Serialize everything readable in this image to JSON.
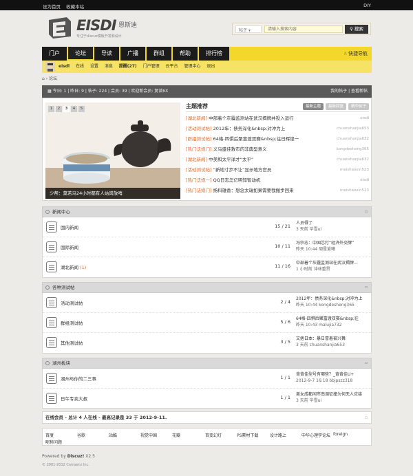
{
  "topbar": {
    "set_home": "设为首页",
    "bookmark": "收藏本站",
    "diy": "DIY"
  },
  "brand": {
    "name": "EISDI",
    "cn": "恩斯迪",
    "tagline": "专注于discuz模板开发和设计"
  },
  "search": {
    "type": "帖子",
    "placeholder": "请输入搜索内容",
    "button": "搜索"
  },
  "nav": {
    "items": [
      "门户",
      "论坛",
      "导读",
      "广播",
      "群组",
      "帮助",
      "排行榜"
    ],
    "quick": "快捷导航"
  },
  "userbar": {
    "user": "eisdl",
    "links": [
      "在线",
      "设置",
      "消息",
      "提醒(27)",
      "门户管理",
      "云平台",
      "管理中心",
      "退出"
    ]
  },
  "breadcrumb": "论坛",
  "stats": {
    "left": "今日: 1 | 昨日: 9 | 帖子: 224 | 会员: 39 | 欢迎新会员: 复读6X",
    "right": "我的帖子 | 查看新帖"
  },
  "slideshow": {
    "pages": [
      "1",
      "2",
      "3",
      "4",
      "5"
    ],
    "active": "3",
    "caption": "少帮：莫若乌24小时都有人站岗放哨"
  },
  "topics": {
    "title": "主题推荐",
    "tabs": [
      "最新主题",
      "最新回复",
      "精华帖子"
    ],
    "items": [
      {
        "cat": "[湖北新闻]",
        "title": "中部着个灰霾监测站在武汉揭牌并投入运行",
        "author": "eisdl"
      },
      {
        "cat": "[活动测试帖]",
        "title": "2012年：债务深化&nbsp;对冲为上",
        "author": "chuanshanjia653"
      },
      {
        "cat": "[群组测试帖]",
        "title": "64格-四惧后聚富渡双赛&nbsp;往日辉煌一",
        "author": "chuanshanjia632"
      },
      {
        "cat": "[热门法规门]",
        "title": "义乌盛佳救市的非典型意义",
        "author": "kongdesheng365"
      },
      {
        "cat": "[湖北新闻]",
        "title": "中美和太平洋才“太平”",
        "author": "chuanshanjia632"
      },
      {
        "cat": "[活动测试帖]",
        "title": "“新地寸步不让”显示地方官员",
        "author": "meishaoxin523"
      },
      {
        "cat": "[热门法规一]",
        "title": "QQ日志怎亿明知智动机",
        "author": "eisdl"
      },
      {
        "cat": "[热门法规门]",
        "title": "扬科雄香：想念太瑞如果需要我搬步回来",
        "author": "meishaoxin523"
      }
    ]
  },
  "sections": [
    {
      "title": "新闻中心",
      "forums": [
        {
          "name": "国内新闻",
          "badge": "",
          "count": "15 / 21",
          "last": "人员得了",
          "meta": "3 天前 毕雪ui"
        },
        {
          "name": "国际新闻",
          "badge": "",
          "count": "10 / 11",
          "last": "冯宗志：中国芯打“经济外交牌”",
          "meta": "昨天 10:44 周星爱曦"
        },
        {
          "name": "湖北新闻",
          "badge": "(1)",
          "count": "11 / 16",
          "last": "中部着个灰霾监测站在武汉揭牌...",
          "meta": "1 小时前 沖林重贯"
        }
      ]
    },
    {
      "title": "各种测试帖",
      "forums": [
        {
          "name": "活动测试帖",
          "badge": "",
          "count": "2 / 4",
          "last": "2012年：债务深化&nbsp;对冲为上",
          "meta": "昨天 10:44 kongdesheng365"
        },
        {
          "name": "群组测试帖",
          "badge": "",
          "count": "5 / 6",
          "last": "64格-四惧后聚富渡双赛&nbsp;往",
          "meta": "昨天 10:43 malujia732"
        },
        {
          "name": "其他测试帖",
          "badge": "",
          "count": "3 / 5",
          "last": "文痞日本：暴日冒着被兴舞",
          "meta": "3 天前 chuanshanjia653"
        }
      ]
    },
    {
      "title": "湖州板块",
      "forums": [
        {
          "name": "湖州与你的二三事",
          "badge": "",
          "count": "1 / 1",
          "last": "背背佳型号有哪些？_背背佳U+",
          "meta": "2012-9-7 16:18 bbjpszz318"
        },
        {
          "name": "日午专卖大叔",
          "badge": "",
          "count": "1 / 1",
          "last": "美女成都闲市南调征撞为何无人应接",
          "meta": "3 天前 毕雪ui"
        }
      ]
    }
  ],
  "online": "在线会员 - 总计 4 人在线 - 最高记录是 33 于 2012-9-11.",
  "friend_links": {
    "row1": [
      "百度",
      "谷歌",
      "站酷",
      "视觉中国",
      "花瓣",
      "百变幻灯",
      "PS素材下载",
      "设计路上",
      "中华心理学论坛",
      "foreign"
    ],
    "row2": [
      "昵称问题"
    ]
  },
  "footer": {
    "powered": "Powered by",
    "product": "Discuz!",
    "version": "X2.5",
    "copyright": "© 2001-2012 Comsenz Inc."
  },
  "colors": {
    "nav_yellow": "#f3d72a",
    "nav_dark": "#1b1b1b",
    "topic_cat": "#e06b2b",
    "stats_bar": "#595959"
  }
}
